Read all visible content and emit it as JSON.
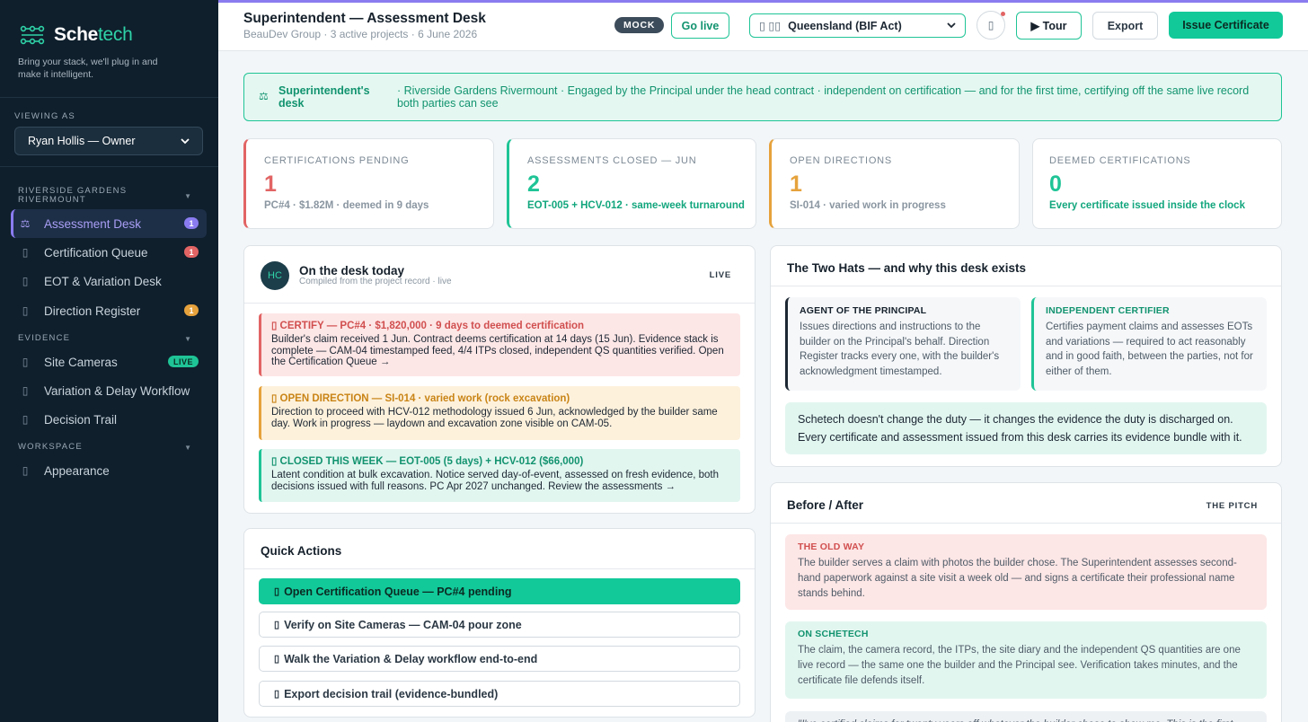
{
  "brand": {
    "name_main": "Sche",
    "name_accent": "tech",
    "tagline": "Bring your stack, we'll plug in and make it intelligent."
  },
  "sidebar": {
    "viewing_as_label": "VIEWING AS",
    "viewer": "Ryan Hollis — Owner",
    "sections": [
      {
        "label": "RIVERSIDE GARDENS RIVERMOUNT"
      },
      {
        "label": "EVIDENCE"
      },
      {
        "label": "WORKSPACE"
      }
    ],
    "items": [
      {
        "label": "Assessment Desk",
        "icon": "scales-icon",
        "badge": "1"
      },
      {
        "label": "Certification Queue",
        "icon": "queue-icon",
        "badge": "1"
      },
      {
        "label": "EOT & Variation Desk",
        "icon": "desk-icon",
        "badge": ""
      },
      {
        "label": "Direction Register",
        "icon": "register-icon",
        "badge": "1"
      },
      {
        "label": "Site Cameras",
        "icon": "camera-icon",
        "badge": "LIVE"
      },
      {
        "label": "Variation & Delay Workflow",
        "icon": "workflow-icon",
        "badge": ""
      },
      {
        "label": "Decision Trail",
        "icon": "trail-icon",
        "badge": ""
      },
      {
        "label": "Appearance",
        "icon": "palette-icon",
        "badge": ""
      }
    ]
  },
  "header": {
    "title": "Superintendent — Assessment Desk",
    "subtitle": "BeauDev Group · 3 active projects · 6 June 2026",
    "mode_badge": "MOCK",
    "go_live_label": "Go live",
    "region": "Queensland (BIF Act)",
    "tour_label": "▶ Tour",
    "export_label": "Export",
    "issue_label": "Issue Certificate"
  },
  "banner": {
    "title": "Superintendent's desk",
    "text": "· Riverside Gardens Rivermount · Engaged by the Principal under the head contract · independent on certification — and for the first time, certifying off the same live record both parties can see"
  },
  "kpis": [
    {
      "label": "CERTIFICATIONS PENDING",
      "value": "1",
      "note": "PC#4 · $1.82M · deemed in 9 days",
      "color": "#e26464"
    },
    {
      "label": "ASSESSMENTS CLOSED — JUN",
      "value": "2",
      "note": "EOT-005 + HCV-012 · same-week turnaround",
      "color": "#1fc496"
    },
    {
      "label": "OPEN DIRECTIONS",
      "value": "1",
      "note": "SI-014 · varied work in progress",
      "color": "#e6a23c"
    },
    {
      "label": "DEEMED CERTIFICATIONS",
      "value": "0",
      "note": "Every certificate issued inside the clock",
      "color": "#1fc496"
    }
  ],
  "desk": {
    "avatar": "HC",
    "title": "On the desk today",
    "subtitle": "Compiled from the project record · live",
    "tag": "LIVE",
    "items": [
      {
        "title": "CERTIFY — PC#4 · $1,820,000 · 9 days to deemed certification",
        "body": "Builder's claim received 1 Jun. Contract deems certification at 14 days (15 Jun). Evidence stack is complete — CAM-04 timestamped feed, 4/4 ITPs closed, independent QS quantities verified. Open the Certification Queue →"
      },
      {
        "title": "OPEN DIRECTION — SI-014 · varied work (rock excavation)",
        "body": "Direction to proceed with HCV-012 methodology issued 6 Jun, acknowledged by the builder same day. Work in progress — laydown and excavation zone visible on CAM-05."
      },
      {
        "title": "CLOSED THIS WEEK — EOT-005 (5 days) + HCV-012 ($66,000)",
        "body": "Latent condition at bulk excavation. Notice served day-of-event, assessed on fresh evidence, both decisions issued with full reasons. PC Apr 2027 unchanged. Review the assessments →"
      }
    ]
  },
  "quick_actions": {
    "title": "Quick Actions",
    "items": [
      {
        "label": "Open Certification Queue — PC#4 pending"
      },
      {
        "label": "Verify on Site Cameras — CAM-04 pour zone"
      },
      {
        "label": "Walk the Variation & Delay workflow end-to-end"
      },
      {
        "label": "Export decision trail (evidence-bundled)"
      }
    ]
  },
  "two_hats": {
    "title": "The Two Hats — and why this desk exists",
    "hats": [
      {
        "title": "AGENT OF THE PRINCIPAL",
        "body": "Issues directions and instructions to the builder on the Principal's behalf. Direction Register tracks every one, with the builder's acknowledgment timestamped."
      },
      {
        "title": "INDEPENDENT CERTIFIER",
        "body": "Certifies payment claims and assesses EOTs and variations — required to act reasonably and in good faith, between the parties, not for either of them."
      }
    ],
    "quote": "Schetech doesn't change the duty — it changes the evidence the duty is discharged on. Every certificate and assessment issued from this desk carries its evidence bundle with it."
  },
  "before_after": {
    "title": "Before / After",
    "tag": "THE PITCH",
    "old_title": "THE OLD WAY",
    "old_body": "The builder serves a claim with photos the builder chose. The Superintendent assesses second-hand paperwork against a site visit a week old — and signs a certificate their professional name stands behind.",
    "new_title": "ON SCHETECH",
    "new_body": "The claim, the camera record, the ITPs, the site diary and the independent QS quantities are one live record — the same one the builder and the Principal see. Verification takes minutes, and the certificate file defends itself.",
    "quote": "\"I've certified claims for twenty years off whatever the builder chose to show me. This is the first time"
  }
}
